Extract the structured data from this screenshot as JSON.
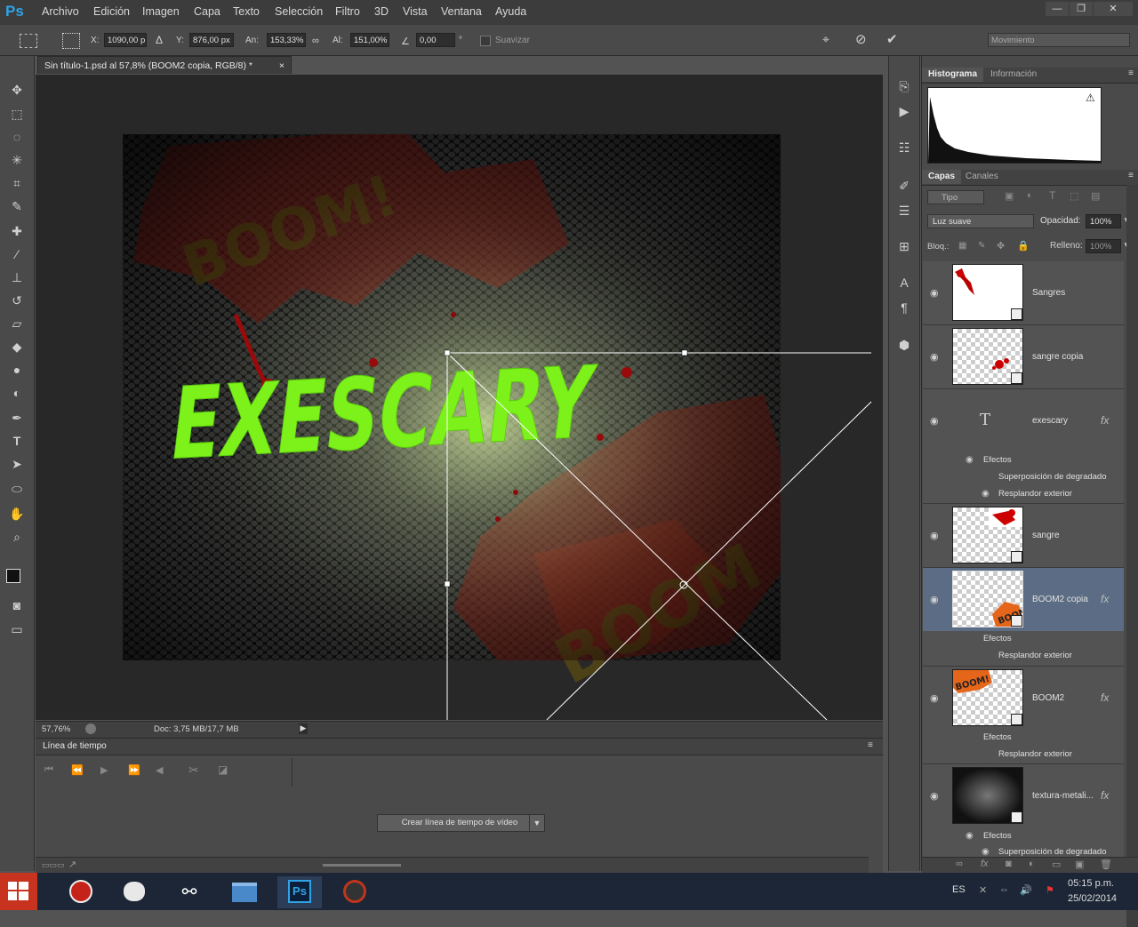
{
  "app": {
    "logo": "Ps"
  },
  "menu": [
    "Archivo",
    "Edición",
    "Imagen",
    "Capa",
    "Texto",
    "Selección",
    "Filtro",
    "3D",
    "Vista",
    "Ventana",
    "Ayuda"
  ],
  "window_controls": {
    "minimize": "—",
    "restore": "❐",
    "close": "✕"
  },
  "options": {
    "x_label": "X:",
    "x_value": "1090,00 p",
    "y_label": "Y:",
    "y_value": "876,00 px",
    "w_label": "An:",
    "w_value": "153,33%",
    "h_label": "Al:",
    "h_value": "151,00%",
    "angle_value": "0,00",
    "angle_unit": "°",
    "smooth_label": "Suavizar",
    "mode_select": "Movimiento"
  },
  "document": {
    "tab_title": "Sin título-1.psd al 57,8% (BOOM2 copia, RGB/8) *",
    "tab_close": "×",
    "canvas_text": "EXESCARY",
    "boom_top": "BOOM!",
    "boom_bottom": "BOOM",
    "zoom": "57,76%",
    "doc_info": "Doc: 3,75 MB/17,7 MB"
  },
  "timeline": {
    "title": "Línea de tiempo",
    "create_button": "Crear línea de tiempo de vídeo"
  },
  "panels": {
    "histogram_tab": "Histograma",
    "info_tab": "Información",
    "layers_tab": "Capas",
    "channels_tab": "Canales",
    "filter_type": "Tipo",
    "blend_mode": "Luz suave",
    "opacity_label": "Opacidad:",
    "opacity_value": "100%",
    "lock_label": "Bloq.:",
    "fill_label": "Relleno:",
    "fill_value": "100%"
  },
  "layers": [
    {
      "name": "Sangres"
    },
    {
      "name": "sangre copia"
    },
    {
      "name": "exescary",
      "fx": "fx",
      "effects_label": "Efectos",
      "effects": [
        "Superposición de degradado",
        "Resplandor exterior"
      ]
    },
    {
      "name": "sangre"
    },
    {
      "name": "BOOM2 copia",
      "fx": "fx",
      "effects_label": "Efectos",
      "effects": [
        "Resplandor exterior"
      ],
      "selected": true
    },
    {
      "name": "BOOM2",
      "fx": "fx",
      "effects_label": "Efectos",
      "effects": [
        "Resplandor exterior"
      ]
    },
    {
      "name": "textura-metali...",
      "fx": "fx",
      "effects_label": "Efectos",
      "effects": [
        "Superposición de degradado"
      ]
    }
  ],
  "taskbar": {
    "lang": "ES",
    "time": "05:15 p.m.",
    "date": "25/02/2014",
    "apps": [
      "windows-start",
      "opera",
      "chat",
      "steam",
      "explorer",
      "photoshop",
      "browser"
    ]
  },
  "colors": {
    "accent_green": "#7cf21a",
    "selection_blue": "#5b6c84",
    "ps_blue": "#2fa3e6"
  }
}
